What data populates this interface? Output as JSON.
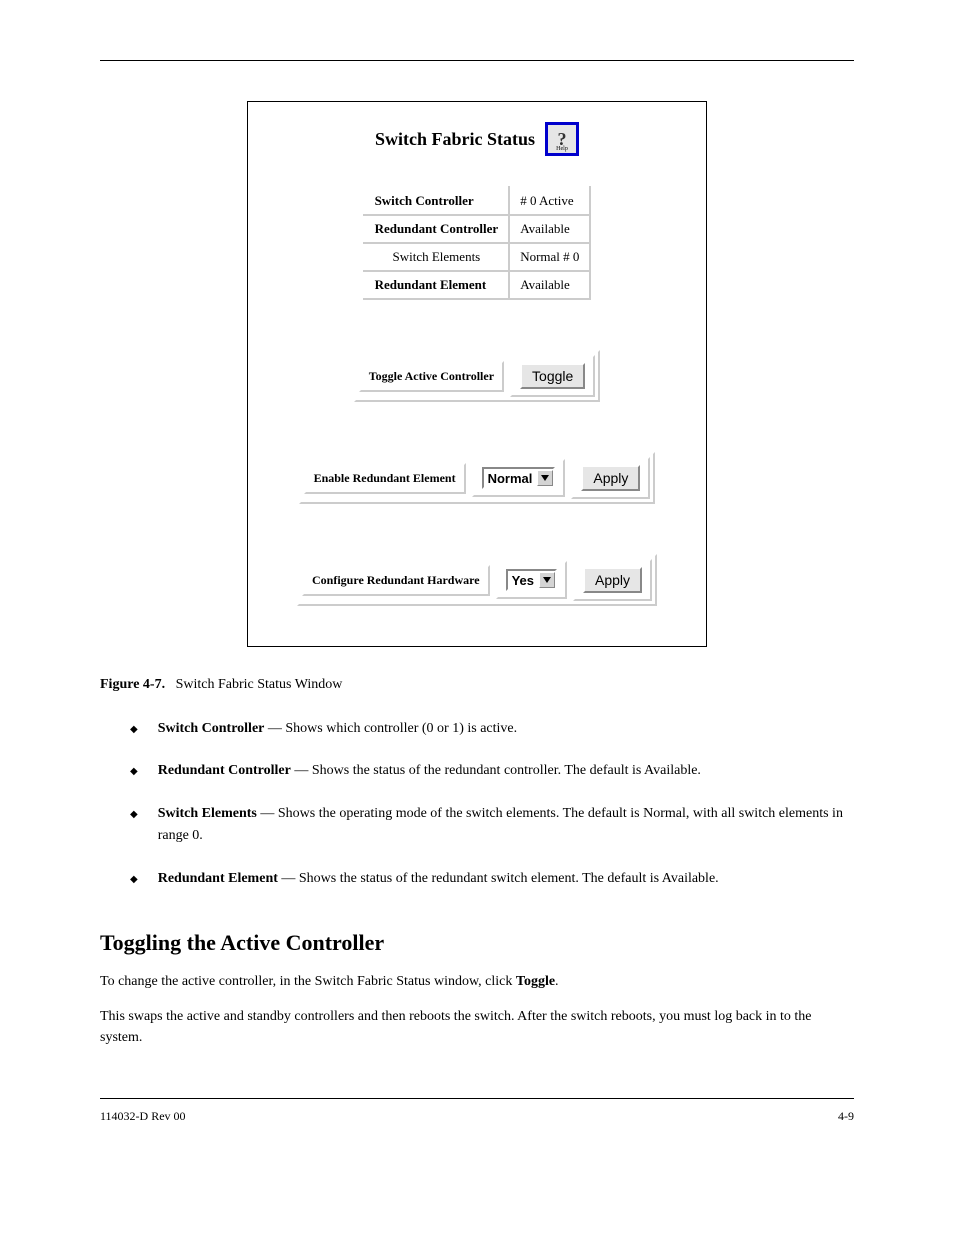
{
  "panel": {
    "title": "Switch Fabric Status",
    "help_q": "?",
    "help_label": "Help",
    "status_rows": [
      {
        "label": "Switch Controller",
        "bold": true,
        "value": "# 0 Active"
      },
      {
        "label": "Redundant Controller",
        "bold": true,
        "value": "Available"
      },
      {
        "label": "Switch Elements",
        "bold": false,
        "value": "Normal # 0"
      },
      {
        "label": "Redundant Element",
        "bold": true,
        "value": "Available"
      }
    ],
    "toggle": {
      "label": "Toggle Active Controller",
      "button": "Toggle"
    },
    "enable": {
      "label": "Enable Redundant Element",
      "select": "Normal",
      "button": "Apply"
    },
    "configure": {
      "label": "Configure Redundant Hardware",
      "select": "Yes",
      "button": "Apply"
    }
  },
  "figure_caption_label": "Figure 4-7.",
  "figure_caption_text": "Switch Fabric Status Window",
  "descriptions": [
    {
      "term": "Switch Controller",
      "text": " — Shows which controller (0 or 1) is active."
    },
    {
      "term": "Redundant Controller",
      "text": " — Shows the status of the redundant controller. The default is Available."
    },
    {
      "term": "Switch Elements",
      "text": " — Shows the operating mode of the switch elements. The default is Normal, with all switch elements in range 0."
    },
    {
      "term": "Redundant Element",
      "text": " — Shows the status of the redundant switch element. The default is Available."
    }
  ],
  "section_heading": "Toggling the Active Controller",
  "para1_pre": "To change the active controller, in the Switch Fabric Status window, click ",
  "para1_cmd": "Toggle",
  "para1_post": ".",
  "para2": "This swaps the active and standby controllers and then reboots the switch. After the switch reboots, you must log back in to the system.",
  "footer": {
    "left": "114032-D Rev 00",
    "right": "4-9"
  }
}
